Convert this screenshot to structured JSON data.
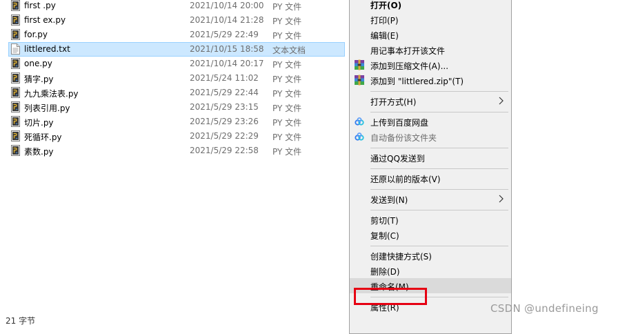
{
  "files": [
    {
      "name": "first .py",
      "date": "2021/10/14 20:00",
      "type": "PY 文件",
      "icon": "python-file-icon",
      "selected": false
    },
    {
      "name": "first ex.py",
      "date": "2021/10/14 21:28",
      "type": "PY 文件",
      "icon": "python-file-icon",
      "selected": false
    },
    {
      "name": "for.py",
      "date": "2021/5/29 22:49",
      "type": "PY 文件",
      "icon": "python-file-icon",
      "selected": false
    },
    {
      "name": "littlered.txt",
      "date": "2021/10/15 18:58",
      "type": "文本文档",
      "icon": "text-file-icon",
      "selected": true
    },
    {
      "name": "one.py",
      "date": "2021/10/14 20:17",
      "type": "PY 文件",
      "icon": "python-file-icon",
      "selected": false
    },
    {
      "name": "猜字.py",
      "date": "2021/5/24 11:02",
      "type": "PY 文件",
      "icon": "python-file-icon",
      "selected": false
    },
    {
      "name": "九九乘法表.py",
      "date": "2021/5/29 22:44",
      "type": "PY 文件",
      "icon": "python-file-icon",
      "selected": false
    },
    {
      "name": "列表引用.py",
      "date": "2021/5/29 23:15",
      "type": "PY 文件",
      "icon": "python-file-icon",
      "selected": false
    },
    {
      "name": "切片.py",
      "date": "2021/5/29 23:26",
      "type": "PY 文件",
      "icon": "python-file-icon",
      "selected": false
    },
    {
      "name": "死循环.py",
      "date": "2021/5/29 22:29",
      "type": "PY 文件",
      "icon": "python-file-icon",
      "selected": false
    },
    {
      "name": "素数.py",
      "date": "2021/5/29 22:58",
      "type": "PY 文件",
      "icon": "python-file-icon",
      "selected": false
    }
  ],
  "status": {
    "text": "21 字节"
  },
  "context_menu": {
    "items": [
      {
        "label": "打开(O)",
        "name": "menu-open",
        "bold": true
      },
      {
        "label": "打印(P)",
        "name": "menu-print"
      },
      {
        "label": "编辑(E)",
        "name": "menu-edit"
      },
      {
        "label": "用记事本打开该文件",
        "name": "menu-open-notepad"
      },
      {
        "label": "添加到压缩文件(A)...",
        "name": "menu-add-archive",
        "icon": "winrar-icon"
      },
      {
        "label": "添加到 \"littlered.zip\"(T)",
        "name": "menu-add-zip",
        "icon": "winrar-icon"
      },
      {
        "sep": true
      },
      {
        "label": "打开方式(H)",
        "name": "menu-open-with",
        "submenu": true
      },
      {
        "sep": true
      },
      {
        "label": "上传到百度网盘",
        "name": "menu-upload-baidu",
        "icon": "baidu-netdisk-icon"
      },
      {
        "label": "自动备份该文件夹",
        "name": "menu-auto-backup",
        "icon": "baidu-netdisk-icon",
        "disabled": true
      },
      {
        "sep": true
      },
      {
        "label": "通过QQ发送到",
        "name": "menu-send-qq"
      },
      {
        "sep": true
      },
      {
        "label": "还原以前的版本(V)",
        "name": "menu-restore-versions"
      },
      {
        "sep": true
      },
      {
        "label": "发送到(N)",
        "name": "menu-send-to",
        "submenu": true
      },
      {
        "sep": true
      },
      {
        "label": "剪切(T)",
        "name": "menu-cut"
      },
      {
        "label": "复制(C)",
        "name": "menu-copy"
      },
      {
        "sep": true
      },
      {
        "label": "创建快捷方式(S)",
        "name": "menu-create-shortcut"
      },
      {
        "label": "删除(D)",
        "name": "menu-delete"
      },
      {
        "label": "重命名(M)",
        "name": "menu-rename",
        "highlighted": true
      },
      {
        "sep": true
      },
      {
        "label": "属性(R)",
        "name": "menu-properties"
      }
    ]
  },
  "watermark": {
    "text": "CSDN @undefineing"
  },
  "colors": {
    "selection": "#cce8ff",
    "highlight_box": "#e60012",
    "menu_bg": "#f0f0f0"
  }
}
